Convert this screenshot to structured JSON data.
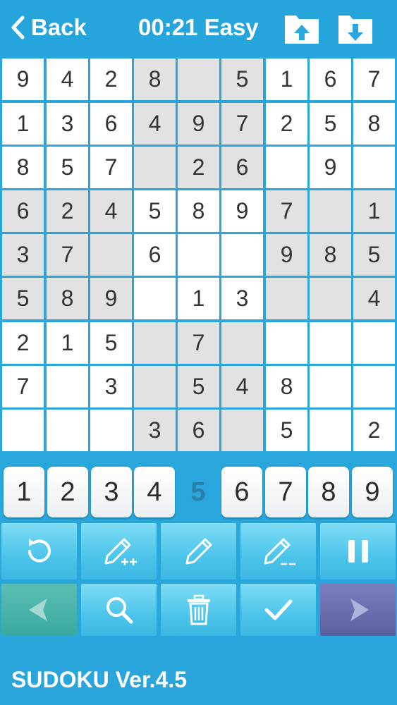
{
  "header": {
    "back_label": "Back",
    "timer": "00:21",
    "difficulty": "Easy",
    "upload_icon": "upload-folder-icon",
    "download_icon": "download-folder-icon"
  },
  "grid": [
    [
      "9",
      "4",
      "2",
      "8",
      "",
      "5",
      "1",
      "6",
      "7"
    ],
    [
      "1",
      "3",
      "6",
      "4",
      "9",
      "7",
      "2",
      "5",
      "8"
    ],
    [
      "8",
      "5",
      "7",
      "",
      "2",
      "6",
      "",
      "9",
      ""
    ],
    [
      "6",
      "2",
      "4",
      "5",
      "8",
      "9",
      "7",
      "",
      "1"
    ],
    [
      "3",
      "7",
      "",
      "6",
      "",
      "",
      "9",
      "8",
      "5"
    ],
    [
      "5",
      "8",
      "9",
      "",
      "1",
      "3",
      "",
      "",
      "4"
    ],
    [
      "2",
      "1",
      "5",
      "",
      "7",
      "",
      "",
      "",
      ""
    ],
    [
      "7",
      "",
      "3",
      "",
      "5",
      "4",
      "8",
      "",
      ""
    ],
    [
      "",
      "",
      "",
      "3",
      "6",
      "",
      "5",
      "",
      "2"
    ]
  ],
  "keypad": {
    "numbers": [
      "1",
      "2",
      "3",
      "4",
      "5",
      "6",
      "7",
      "8",
      "9"
    ],
    "selected": "5"
  },
  "tools": [
    {
      "name": "reset",
      "icon": "refresh-icon"
    },
    {
      "name": "auto-notes",
      "icon": "pencil-plus-icon"
    },
    {
      "name": "note",
      "icon": "pencil-icon"
    },
    {
      "name": "erase-notes",
      "icon": "pencil-minus-icon"
    },
    {
      "name": "pause",
      "icon": "pause-icon"
    },
    {
      "name": "undo",
      "icon": "arrow-left-icon"
    },
    {
      "name": "hint",
      "icon": "search-icon"
    },
    {
      "name": "delete",
      "icon": "trash-icon"
    },
    {
      "name": "check",
      "icon": "check-icon"
    },
    {
      "name": "redo",
      "icon": "arrow-right-icon"
    }
  ],
  "footer": {
    "title": "SUDOKU Ver.4.5"
  },
  "colors": {
    "accent": "#29a6dc",
    "cell_white": "#ffffff",
    "cell_gray": "#e2e2e2",
    "tool_blue": "#4cc4ea"
  }
}
